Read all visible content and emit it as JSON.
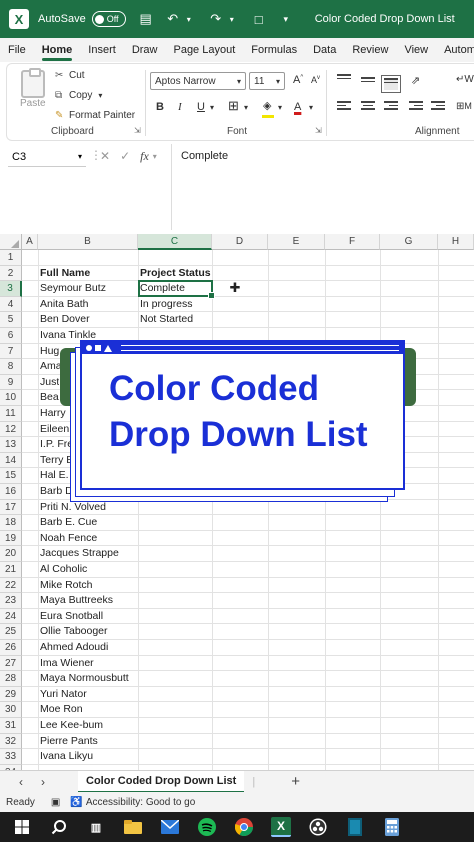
{
  "titlebar": {
    "app_icon": "excel-icon",
    "autosave_label": "AutoSave",
    "autosave_state": "Off",
    "document_title": "Color Coded Drop Down List"
  },
  "menu": {
    "tabs": [
      "File",
      "Home",
      "Insert",
      "Draw",
      "Page Layout",
      "Formulas",
      "Data",
      "Review",
      "View",
      "Automate"
    ],
    "active": "Home"
  },
  "ribbon": {
    "clipboard": {
      "group_label": "Clipboard",
      "paste": "Paste",
      "cut": "Cut",
      "copy": "Copy",
      "format_painter": "Format Painter"
    },
    "font": {
      "group_label": "Font",
      "font_name": "Aptos Narrow",
      "font_size": "11",
      "bold": "B",
      "italic": "I",
      "underline": "U",
      "font_color_glyph": "A"
    },
    "alignment": {
      "group_label": "Alignment",
      "wrap_partial": "W"
    }
  },
  "formula_bar": {
    "name_box": "C3",
    "fx": "fx",
    "value": "Complete"
  },
  "grid": {
    "columns": [
      "A",
      "B",
      "C",
      "D",
      "E",
      "F",
      "G",
      "H"
    ],
    "selected_column": "C",
    "selected_row": 3,
    "rows": [
      "1",
      "2",
      "3",
      "4",
      "5",
      "6",
      "7",
      "8",
      "9",
      "10",
      "11",
      "12",
      "13",
      "14",
      "15",
      "16",
      "17",
      "18",
      "19",
      "20",
      "21",
      "22",
      "23",
      "24",
      "25",
      "26",
      "27",
      "28",
      "29",
      "30",
      "31",
      "32",
      "33",
      "34"
    ],
    "header_full_name": "Full Name",
    "header_status": "Project Status",
    "names": [
      "Seymour Butz",
      "Anita Bath",
      "Ben Dover",
      "Ivana Tinkle",
      "Hug",
      "Ama",
      "Just",
      "Bea",
      "Harry",
      "Eileen",
      "I.P. Fre",
      "Terry B",
      "Hal E.",
      "Barb D",
      "Priti N. Volved",
      "Barb E. Cue",
      "Noah Fence",
      "Jacques Strappe",
      "Al Coholic",
      "Mike Rotch",
      "Maya Buttreeks",
      "Eura Snotball",
      "Ollie Tabooger",
      "Ahmed Adoudi",
      "Ima Wiener",
      "Maya Normousbutt",
      "Yuri Nator",
      "Moe Ron",
      "Lee Kee-bum",
      "Pierre Pants",
      "Ivana Likyu"
    ],
    "statuses": [
      "Complete",
      "In progress",
      "Not Started"
    ]
  },
  "overlay": {
    "line1": "Color Coded",
    "line2": "Drop Down List",
    "accent": "#1a2fd6",
    "strip_color": "#3d6b3f"
  },
  "sheets": {
    "active": "Color Coded Drop Down List",
    "add": "+"
  },
  "status": {
    "ready": "Ready",
    "accessibility": "Accessibility: Good to go"
  },
  "colors": {
    "excel_green": "#1e7145"
  }
}
